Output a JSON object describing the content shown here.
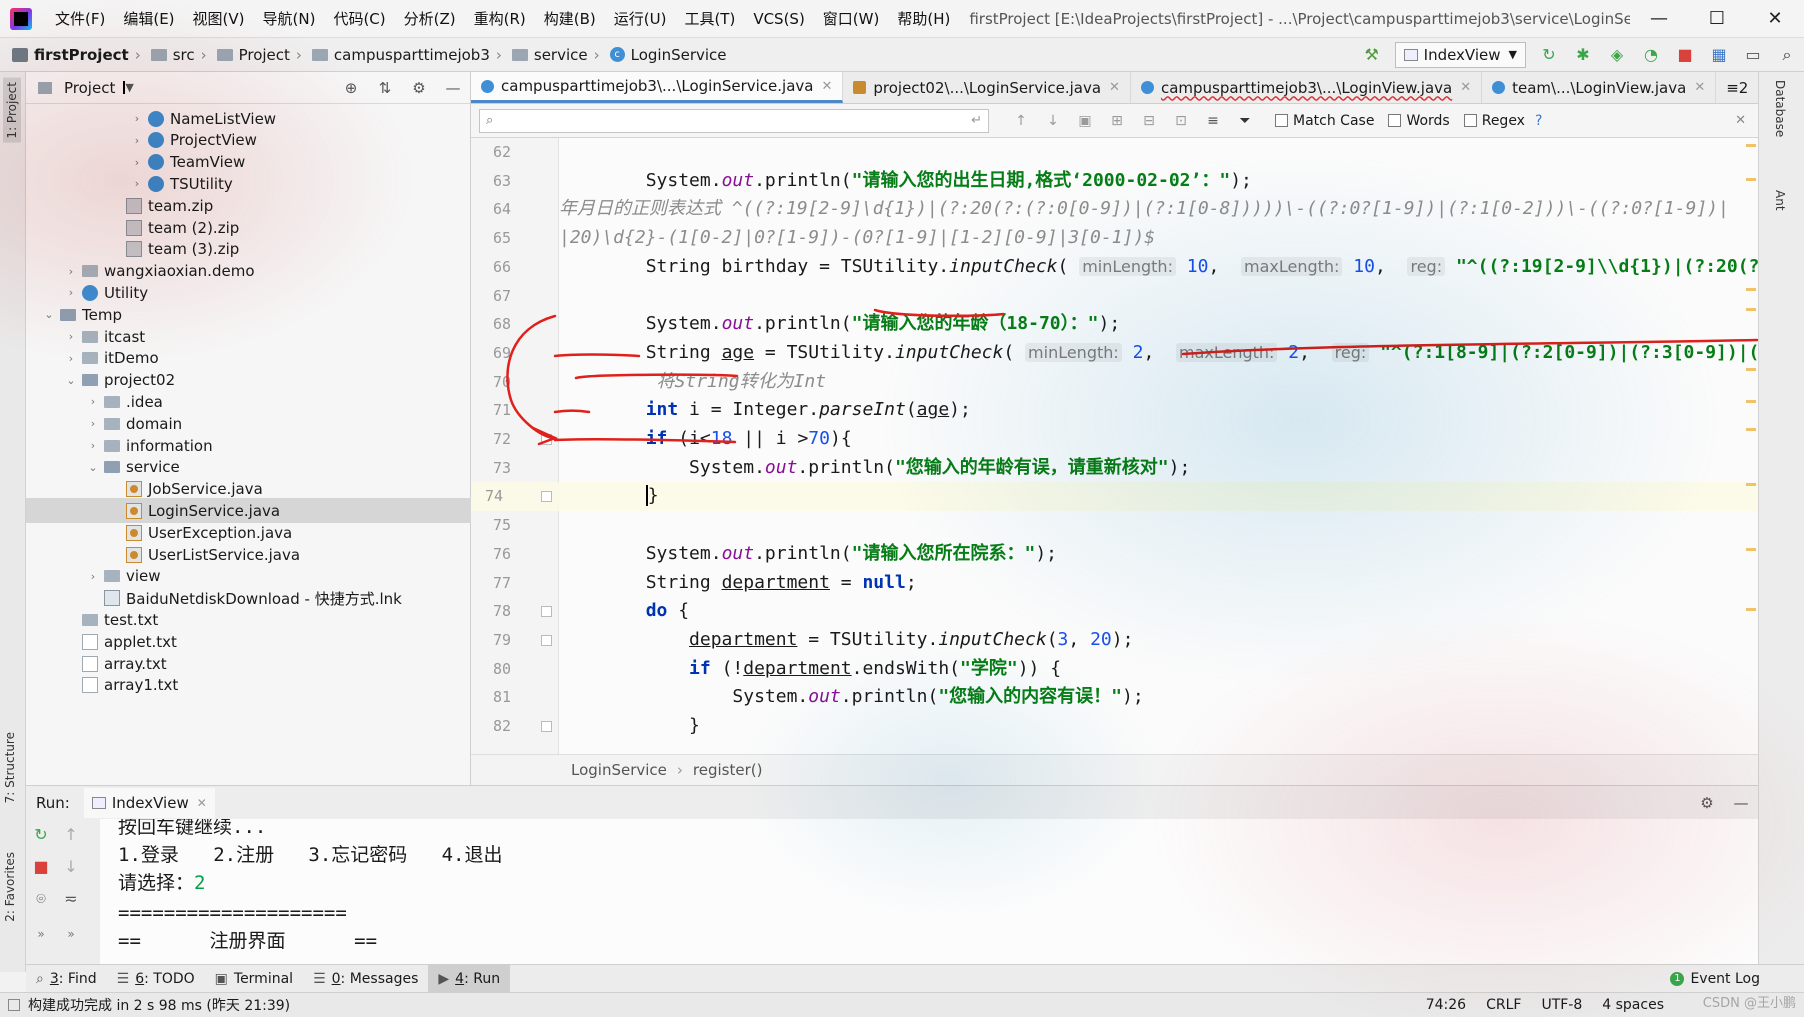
{
  "menu": {
    "items": [
      "文件(F)",
      "编辑(E)",
      "视图(V)",
      "导航(N)",
      "代码(C)",
      "分析(Z)",
      "重构(R)",
      "构建(B)",
      "运行(U)",
      "工具(T)",
      "VCS(S)",
      "窗口(W)",
      "帮助(H)"
    ],
    "window_title": "firstProject [E:\\IdeaProjects\\firstProject] - ...\\Project\\campusparttimejob3\\service\\LoginService.java"
  },
  "breadcrumbs": [
    "firstProject",
    "src",
    "Project",
    "campusparttimejob3",
    "service",
    "LoginService"
  ],
  "run_config": "IndexView",
  "left_tabs": [
    "1: Project",
    "7: Structure",
    "2: Favorites"
  ],
  "right_tabs": [
    "Database",
    "Ant"
  ],
  "project": {
    "title": "Project",
    "tree": [
      {
        "label": "NameListView",
        "icon": "cls",
        "indent": 5,
        "arrow": "›"
      },
      {
        "label": "ProjectView",
        "icon": "cls",
        "indent": 5,
        "arrow": "›"
      },
      {
        "label": "TeamView",
        "icon": "cls",
        "indent": 5,
        "arrow": "›"
      },
      {
        "label": "TSUtility",
        "icon": "cls",
        "indent": 5,
        "arrow": "›"
      },
      {
        "label": "team.zip",
        "icon": "zip",
        "indent": 4,
        "arrow": ""
      },
      {
        "label": "team (2).zip",
        "icon": "zip",
        "indent": 4,
        "arrow": ""
      },
      {
        "label": "team (3).zip",
        "icon": "zip",
        "indent": 4,
        "arrow": ""
      },
      {
        "label": "wangxiaoxian.demo",
        "icon": "folder",
        "indent": 2,
        "arrow": "›"
      },
      {
        "label": "Utility",
        "icon": "cls",
        "indent": 2,
        "arrow": "›"
      },
      {
        "label": "Temp",
        "icon": "folder",
        "indent": 1,
        "arrow": "⌄"
      },
      {
        "label": "itcast",
        "icon": "folder",
        "indent": 2,
        "arrow": "›"
      },
      {
        "label": "itDemo",
        "icon": "folder",
        "indent": 2,
        "arrow": "›"
      },
      {
        "label": "project02",
        "icon": "folder",
        "indent": 2,
        "arrow": "⌄"
      },
      {
        "label": ".idea",
        "icon": "folder",
        "indent": 3,
        "arrow": "›"
      },
      {
        "label": "domain",
        "icon": "folder",
        "indent": 3,
        "arrow": "›"
      },
      {
        "label": "information",
        "icon": "folder",
        "indent": 3,
        "arrow": "›"
      },
      {
        "label": "service",
        "icon": "folder",
        "indent": 3,
        "arrow": "⌄"
      },
      {
        "label": "JobService.java",
        "icon": "java",
        "indent": 4,
        "arrow": ""
      },
      {
        "label": "LoginService.java",
        "icon": "java",
        "indent": 4,
        "arrow": "",
        "selected": true
      },
      {
        "label": "UserException.java",
        "icon": "java",
        "indent": 4,
        "arrow": ""
      },
      {
        "label": "UserListService.java",
        "icon": "java",
        "indent": 4,
        "arrow": ""
      },
      {
        "label": "view",
        "icon": "folder",
        "indent": 3,
        "arrow": "›"
      },
      {
        "label": "BaiduNetdiskDownload - 快捷方式.lnk",
        "icon": "lnk",
        "indent": 3,
        "arrow": ""
      },
      {
        "label": "test.txt",
        "icon": "folder",
        "indent": 2,
        "arrow": ""
      },
      {
        "label": "applet.txt",
        "icon": "txt",
        "indent": 2,
        "arrow": ""
      },
      {
        "label": "array.txt",
        "icon": "txt",
        "indent": 2,
        "arrow": ""
      },
      {
        "label": "array1.txt",
        "icon": "txt",
        "indent": 2,
        "arrow": ""
      }
    ]
  },
  "editor_tabs": [
    {
      "label": "campusparttimejob3\\...\\LoginService.java",
      "icon": "cls",
      "active": true
    },
    {
      "label": "project02\\...\\LoginService.java",
      "icon": "java",
      "active": false
    },
    {
      "label": "campusparttimejob3\\...\\LoginView.java",
      "icon": "cls",
      "active": false,
      "modified": true
    },
    {
      "label": "team\\...\\LoginView.java",
      "icon": "cls",
      "active": false
    }
  ],
  "editor_tab_overflow": "≡2",
  "find": {
    "match_case": "Match Case",
    "words": "Words",
    "regex": "Regex",
    "help": "?"
  },
  "code": {
    "line_numbers": [
      "62",
      "63",
      "64",
      "65",
      "66",
      "67",
      "68",
      "69",
      "70",
      "71",
      "72",
      "73",
      "74",
      "75",
      "76",
      "77",
      "78",
      "79",
      "80",
      "81",
      "82"
    ],
    "current_line": "74"
  },
  "annotation_text": "将String转化为Int",
  "editor_breadcrumb": [
    "LoginService",
    "register()"
  ],
  "run": {
    "label": "Run:",
    "tab": "IndexView",
    "console": [
      "按回车键继续...",
      "1.登录   2.注册   3.忘记密码   4.退出",
      "请选择：",
      "====================",
      "==      注册界面      =="
    ],
    "console_input": "2"
  },
  "toolwindows": [
    {
      "key": "3",
      "label": ": Find",
      "glyph": "⌕"
    },
    {
      "key": "6",
      "label": ": TODO",
      "glyph": "☰"
    },
    {
      "key": "",
      "label": "Terminal",
      "glyph": "▣"
    },
    {
      "key": "0",
      "label": ": Messages",
      "glyph": "☰"
    },
    {
      "key": "4",
      "label": ": Run",
      "glyph": "▶",
      "active": true
    }
  ],
  "event_log": "Event Log",
  "status": {
    "message": "构建成功完成 in 2 s 98 ms (昨天 21:39)",
    "position": "74:26",
    "line_sep": "CRLF",
    "encoding": "UTF-8",
    "indent": "4 spaces"
  },
  "watermark": "CSDN @王小鹏"
}
